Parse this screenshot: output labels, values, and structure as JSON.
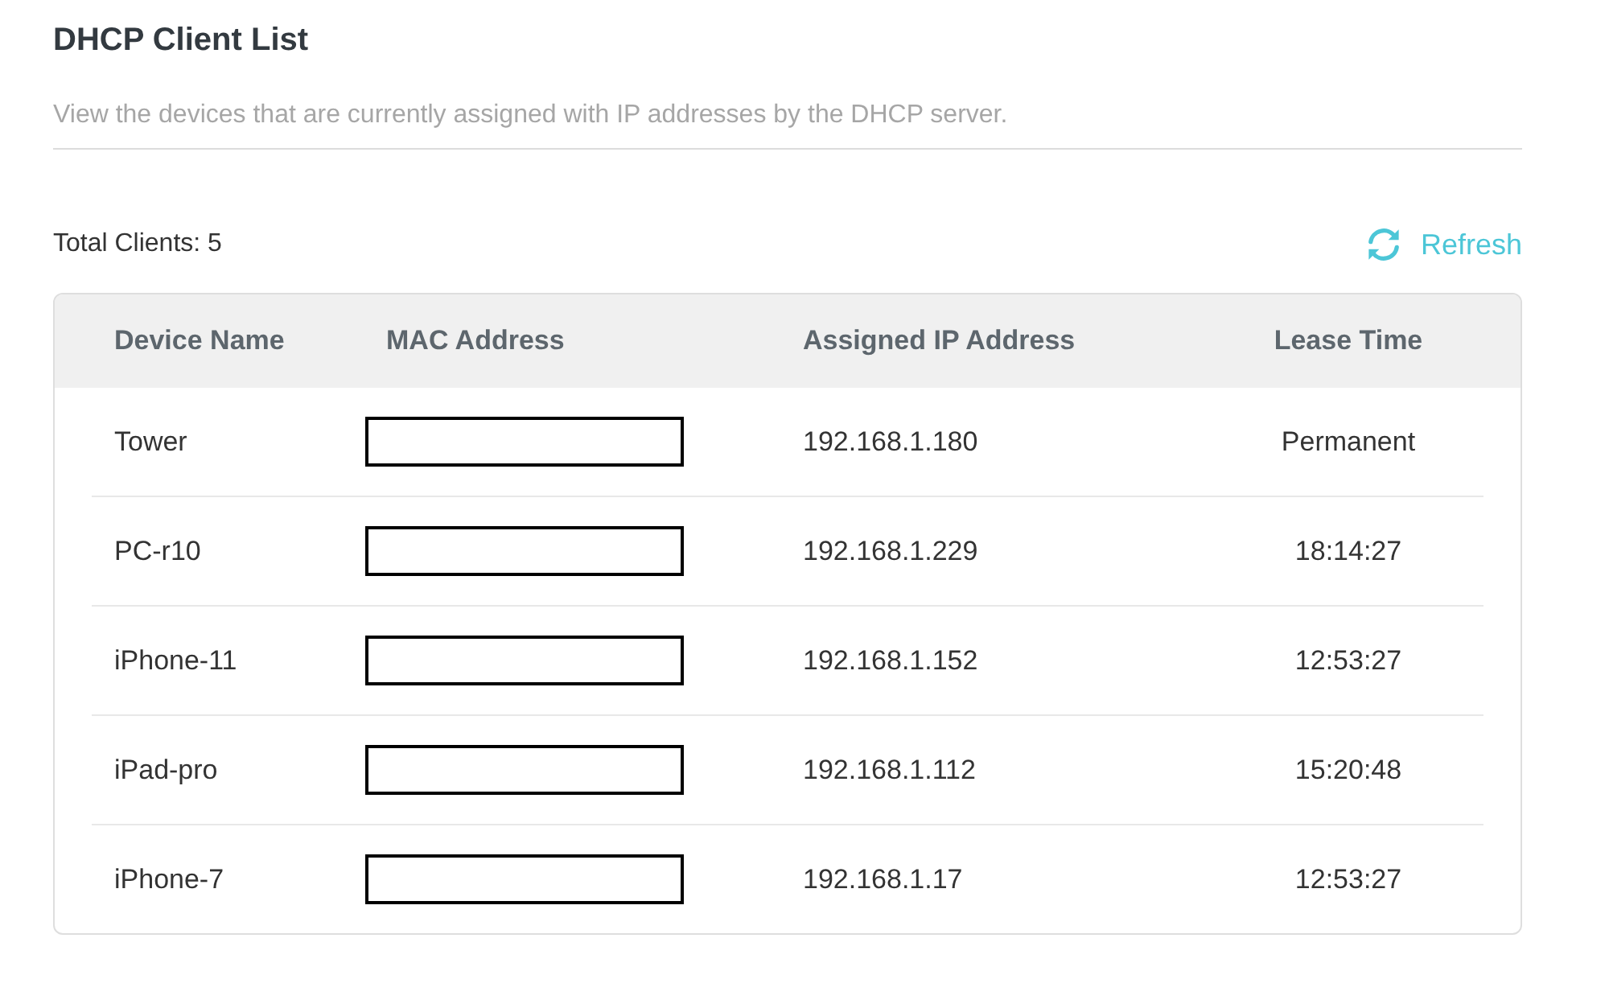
{
  "page": {
    "title": "DHCP Client List",
    "description": "View the devices that are currently assigned with IP addresses by the DHCP server."
  },
  "summary": {
    "total_clients": "Total Clients: 5",
    "refresh_label": "Refresh"
  },
  "table": {
    "columns": [
      "Device Name",
      "MAC Address",
      "Assigned IP Address",
      "Lease Time"
    ],
    "rows": [
      {
        "device_name": "Tower",
        "mac_redacted": true,
        "ip_address": "192.168.1.180",
        "lease_time": "Permanent"
      },
      {
        "device_name": "PC-r10",
        "mac_redacted": true,
        "ip_address": "192.168.1.229",
        "lease_time": "18:14:27"
      },
      {
        "device_name": "iPhone-11",
        "mac_redacted": true,
        "ip_address": "192.168.1.152",
        "lease_time": "12:53:27"
      },
      {
        "device_name": "iPad-pro",
        "mac_redacted": true,
        "ip_address": "192.168.1.112",
        "lease_time": "15:20:48"
      },
      {
        "device_name": "iPhone-7",
        "mac_redacted": true,
        "ip_address": "192.168.1.17",
        "lease_time": "12:53:27"
      }
    ]
  }
}
